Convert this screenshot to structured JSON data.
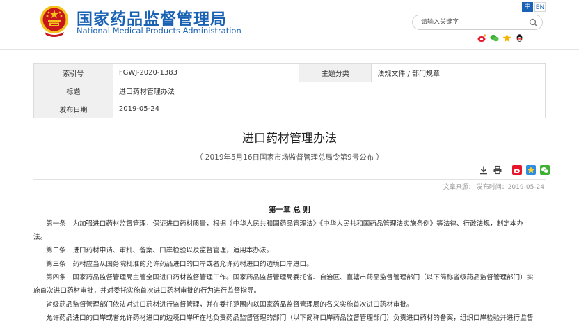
{
  "header": {
    "title_cn": "国家药品监督管理局",
    "title_en": "National Medical Products Administration",
    "lang_cn": "中",
    "lang_en": "EN",
    "search_placeholder": "请输入关键字"
  },
  "info_table": {
    "index_label": "索引号",
    "index_value": "FGWJ-2020-1383",
    "category_label": "主题分类",
    "category_value": "法规文件 / 部门规章",
    "title_label": "标题",
    "title_value": "进口药材管理办法",
    "date_label": "发布日期",
    "date_value": "2019-05-24"
  },
  "document": {
    "title": "进口药材管理办法",
    "subtitle": "（ 2019年5月16日国家市场监督管理总局令第9号公布 ）",
    "meta": "文章来源： 发布时间：2019-05-24",
    "chapter": "第一章 总 则",
    "paragraphs": [
      "第一条　为加强进口药材监督管理，保证进口药材质量，根据《中华人民共和国药品管理法》《中华人民共和国药品管理法实施条例》等法律、行政法规，制定本办",
      "法。",
      "第二条　进口药材申请、审批、备案、口岸检验以及监督管理，适用本办法。",
      "第三条　药材应当从国务院批准的允许药品进口的口岸或者允许药材进口的边境口岸进口。",
      "第四条　国家药品监督管理局主管全国进口药材监督管理工作。国家药品监督管理局委托省、自治区、直辖市药品监督管理部门（以下简称省级药品监督管理部门）实",
      "施首次进口药材审批，并对委托实施首次进口药材审批的行为进行监督指导。",
      "省级药品监督管理部门依法对进口药材进行监督管理，并在委托范围内以国家药品监督管理局的名义实施首次进口药材审批。",
      "允许药品进口的口岸或者允许药材进口的边境口岸所在地负责药品监督管理的部门（以下简称口岸药品监督管理部门）负责进口药材的备案，组织口岸检验并进行监督"
    ]
  },
  "icons": {
    "share_top": [
      "weibo-icon",
      "wechat-icon",
      "qzone-icon",
      "qq-icon"
    ],
    "tools": [
      "download-icon",
      "print-icon",
      "weibo-icon",
      "qzone-icon",
      "wechat-icon"
    ]
  },
  "colors": {
    "brand_blue": "#1a63b4",
    "emblem_red": "#c8161d",
    "emblem_gold": "#f4c21a",
    "table_key_bg": "#f0f0f0"
  }
}
